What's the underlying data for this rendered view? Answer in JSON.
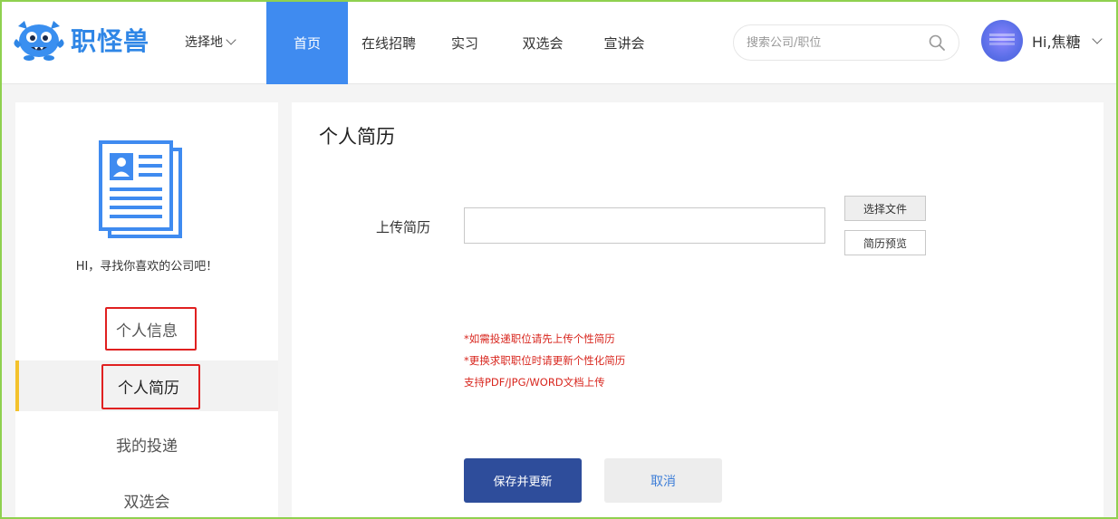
{
  "brand": {
    "name": "职怪兽"
  },
  "header": {
    "location_label": "选择地",
    "nav": [
      {
        "label": "首页",
        "active": true
      },
      {
        "label": "在线招聘",
        "active": false
      },
      {
        "label": "实习",
        "active": false
      },
      {
        "label": "双选会",
        "active": false
      },
      {
        "label": "宣讲会",
        "active": false
      }
    ],
    "search_placeholder": "搜索公司/职位",
    "user_greeting": "Hi,焦糖"
  },
  "sidebar": {
    "greeting": "HI，寻找你喜欢的公司吧！",
    "items": [
      {
        "label": "个人信息",
        "active": false,
        "highlighted": true
      },
      {
        "label": "个人简历",
        "active": true,
        "highlighted": true
      },
      {
        "label": "我的投递",
        "active": false,
        "highlighted": false
      },
      {
        "label": "双选会",
        "active": false,
        "highlighted": false
      }
    ]
  },
  "main": {
    "title": "个人简历",
    "upload_label": "上传简历",
    "choose_file_label": "选择文件",
    "preview_label": "简历预览",
    "notes": [
      "*如需投递职位请先上传个性简历",
      "*更换求职职位时请更新个性化简历",
      "支持PDF/JPG/WORD文档上传"
    ],
    "save_label": "保存并更新",
    "cancel_label": "取消"
  },
  "colors": {
    "nav_active_bg": "#3f8bf0",
    "sidebar_active_accent": "#f3c22c",
    "highlight_box": "#e02020",
    "notes_text": "#d8261e",
    "save_button_bg": "#2e4d9b",
    "page_frame": "#8fd14f"
  },
  "icons": {
    "logo": "monster-mascot-icon",
    "search": "search-icon",
    "location_dropdown": "chevron-down-icon",
    "user_dropdown": "chevron-down-icon",
    "resume": "resume-document-icon"
  }
}
